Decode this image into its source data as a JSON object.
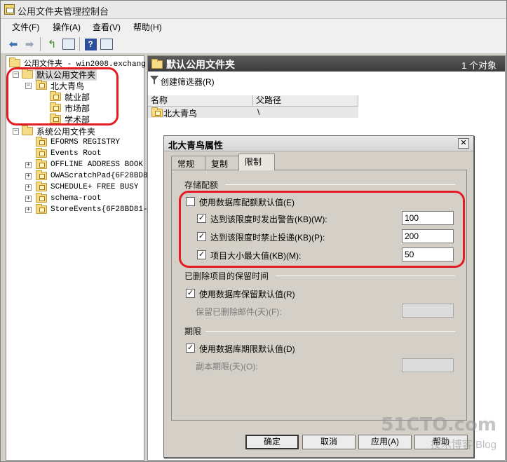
{
  "window": {
    "title": "公用文件夹管理控制台"
  },
  "menu": [
    "文件(F)",
    "操作(A)",
    "查看(V)",
    "帮助(H)"
  ],
  "toolbar": {
    "buttons": [
      "back-icon",
      "forward-icon",
      "up-folder-icon",
      "show-hide-tree-icon",
      "help-icon",
      "show-action-pane-icon"
    ]
  },
  "tree": {
    "root": "公用文件夹 - win2008.exchang",
    "default_folder": "默认公用文件夹",
    "org": "北大青鸟",
    "children": [
      "就业部",
      "市场部",
      "学术部"
    ],
    "system_folder": "系统公用文件夹",
    "system_children": [
      "EFORMS REGISTRY",
      "Events Root",
      "OFFLINE ADDRESS BOOK",
      "OWAScratchPad{6F28BD81",
      "SCHEDULE+ FREE BUSY",
      "schema-root",
      "StoreEvents{6F28BD81-5"
    ]
  },
  "pane": {
    "title": "默认公用文件夹",
    "count": "1 个对象",
    "action": "创建筛选器(R)",
    "col_name": "名称",
    "col_path": "父路径",
    "row_name": "北大青鸟",
    "row_path": "\\"
  },
  "dialog": {
    "title": "北大青鸟属性",
    "close": "✕",
    "tabs": [
      "常规",
      "复制",
      "限制"
    ],
    "storage_group": "存储配额",
    "use_db_quota": "使用数据库配额默认值(E)",
    "warn_label": "达到该限度时发出警告(KB)(W):",
    "warn_value": "100",
    "prohibit_label": "达到该限度时禁止投递(KB)(P):",
    "prohibit_value": "200",
    "maxitem_label": "项目大小最大值(KB)(M):",
    "maxitem_value": "50",
    "deleted_group": "已删除项目的保留时间",
    "use_db_retention": "使用数据库保留默认值(R)",
    "keep_deleted_label": "保留已删除邮件(天)(F):",
    "age_group": "期限",
    "use_db_age": "使用数据库期限默认值(D)",
    "replica_age_label": "副本期限(天)(O):",
    "ok": "确定",
    "cancel": "取消",
    "apply": "应用(A)",
    "help": "帮助"
  },
  "checks": {
    "use_db_quota": false,
    "warn": true,
    "prohibit": true,
    "maxitem": true,
    "use_db_retention": true,
    "use_db_age": true
  },
  "watermark": {
    "line1": "51CTO.com",
    "line2": "技术博客  Blog"
  },
  "colors": {
    "highlight_ring": "#e31b23",
    "header_bg": "#4a4a4a"
  }
}
